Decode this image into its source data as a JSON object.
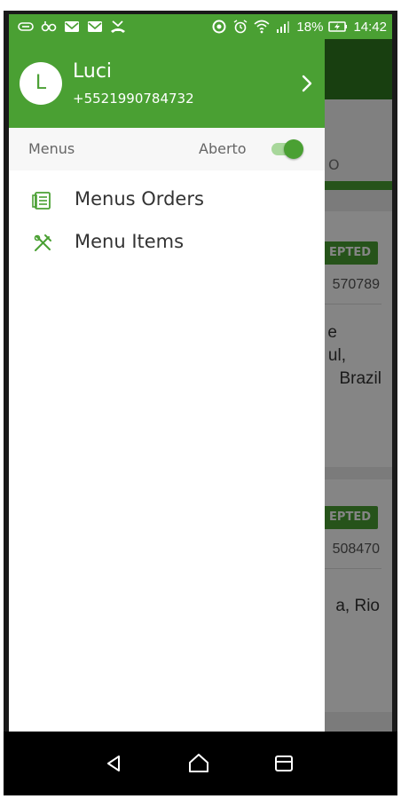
{
  "status_bar": {
    "battery_percent": "18%",
    "time": "14:42",
    "icons": [
      "voicemail-icon",
      "gmail-icon",
      "gmail-icon",
      "missed-call-icon",
      "sync-icon",
      "alarm-icon",
      "wifi-icon",
      "signal-icon",
      "battery-icon"
    ]
  },
  "drawer": {
    "avatar_initial": "L",
    "user_name": "Luci",
    "user_phone": "+5521990784732",
    "section_label": "Menus",
    "toggle_label": "Aberto",
    "toggle_on": true,
    "items": [
      {
        "label": "Menus Orders",
        "icon": "orders-list-icon"
      },
      {
        "label": "Menu Items",
        "icon": "utensils-icon"
      }
    ]
  },
  "background": {
    "cards": [
      {
        "badge": "EPTED",
        "id": "570789",
        "address_lines": [
          "e",
          "ul,",
          "Brazil"
        ]
      },
      {
        "badge": "EPTED",
        "id": "508470",
        "address_lines": [
          "a, Rio"
        ]
      }
    ],
    "tab_text": "O"
  },
  "colors": {
    "primary": "#4aa033",
    "primary_dark": "#2e7a1f",
    "toggle_track": "#a8d79b"
  },
  "nav_bar": {
    "buttons": [
      "back-icon",
      "home-icon",
      "recent-apps-icon"
    ]
  }
}
